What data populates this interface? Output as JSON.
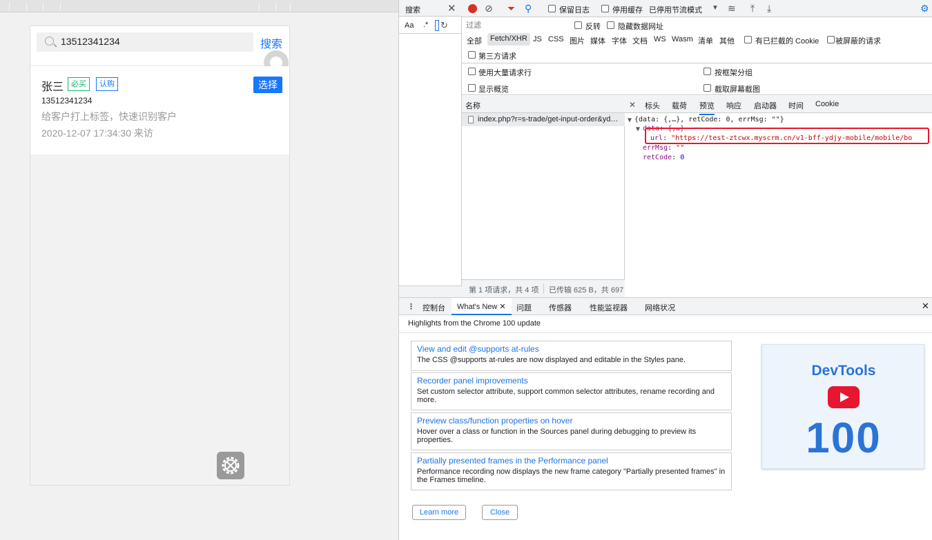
{
  "page": {
    "search": {
      "value": "13512341234",
      "button": "搜索"
    },
    "customer": {
      "name": "张三",
      "tags": [
        "必买",
        "认购"
      ],
      "select_button": "选择",
      "phone": "13512341234",
      "tag_hint": "给客户打上标签，快速识别客户",
      "visit": "2020-12-07 17:34:30 来访"
    }
  },
  "devtools": {
    "search_panel": {
      "tab": "搜索",
      "aa": "Aa",
      "regex": ".*"
    },
    "toolbar": {
      "preserve_log": "保留日志",
      "disable_cache": "停用缓存",
      "throttle": "已停用节流模式"
    },
    "filter": {
      "placeholder": "过滤",
      "invert": "反转",
      "hide_data_urls": "隐藏数据网址"
    },
    "types": [
      "全部",
      "Fetch/XHR",
      "JS",
      "CSS",
      "图片",
      "媒体",
      "字体",
      "文档",
      "WS",
      "Wasm",
      "清单",
      "其他"
    ],
    "blocked_cookies": "有已拦截的 Cookie",
    "blocked_requests": "被屏蔽的请求",
    "third_party": "第三方请求",
    "options": {
      "big_rows": "使用大量请求行",
      "group_by_frame": "按框架分组",
      "overview": "显示概览",
      "screenshots": "截取屏幕截图"
    },
    "request_list": {
      "header": "名称",
      "row": "index.php?r=s-trade/get-input-order&yd…",
      "footer_count": "第 1 项请求，共 4 项",
      "footer_size": "已传输 625 B，共 697"
    },
    "detail_tabs": [
      "标头",
      "载荷",
      "预览",
      "响应",
      "启动器",
      "时间",
      "Cookie"
    ],
    "detail_active": "预览",
    "preview": {
      "line1": "{data: {,…}, retCode: 0, errMsg: \"\"}",
      "line2": "data: {,…}",
      "url_key": "url",
      "url_val": "\"https://test-ztcwx.myscrm.cn/v1-bff-ydjy-mobile/mobile/bo",
      "errmsg_key": "errMsg",
      "errmsg_val": "\"\"",
      "retcode_key": "retCode",
      "retcode_val": "0"
    },
    "drawer": {
      "tabs": [
        "控制台",
        "What's New",
        "问题",
        "传感器",
        "性能监视器",
        "网络状况"
      ],
      "active_tab": "What's New",
      "highlights": "Highlights from the Chrome 100 update",
      "features": [
        {
          "title": "View and edit @supports at-rules",
          "desc": "The CSS @supports at-rules are now displayed and editable in the Styles pane."
        },
        {
          "title": "Recorder panel improvements",
          "desc": "Set custom selector attribute, support common selector attributes, rename recording and more."
        },
        {
          "title": "Preview class/function properties on hover",
          "desc": "Hover over a class or function in the Sources panel during debugging to preview its properties."
        },
        {
          "title": "Partially presented frames in the Performance panel",
          "desc": "Performance recording now displays the new frame category \"Partially presented frames\" in the Frames timeline."
        }
      ],
      "learn_more": "Learn more",
      "close": "Close",
      "promo_title": "DevTools",
      "promo_number": "100"
    }
  }
}
